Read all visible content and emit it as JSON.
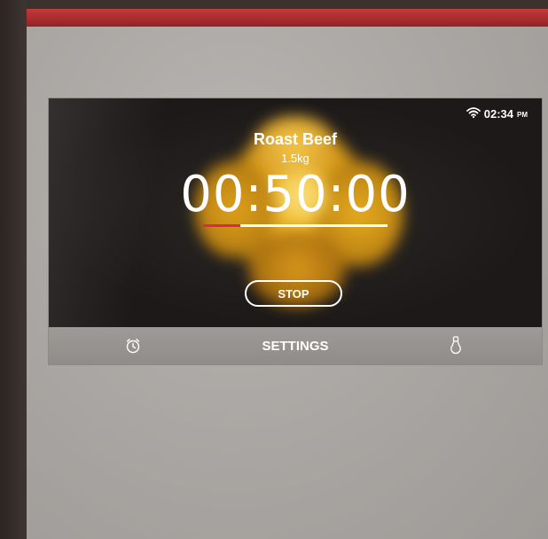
{
  "status_bar": {
    "time": "02:34",
    "ampm": "PM",
    "wifi_icon": "wifi-icon"
  },
  "cooking": {
    "dish_name": "Roast Beef",
    "weight": "1.5kg",
    "timer": "00:50:00",
    "progress_fraction": 0.2
  },
  "controls": {
    "stop_label": "STOP"
  },
  "bottom_bar": {
    "alarm_icon": "alarm-clock-icon",
    "settings_label": "SETTINGS",
    "probe_icon": "temperature-probe-icon"
  },
  "colors": {
    "accent_progress": "#e0245e",
    "brand_strip": "#b3302f"
  }
}
